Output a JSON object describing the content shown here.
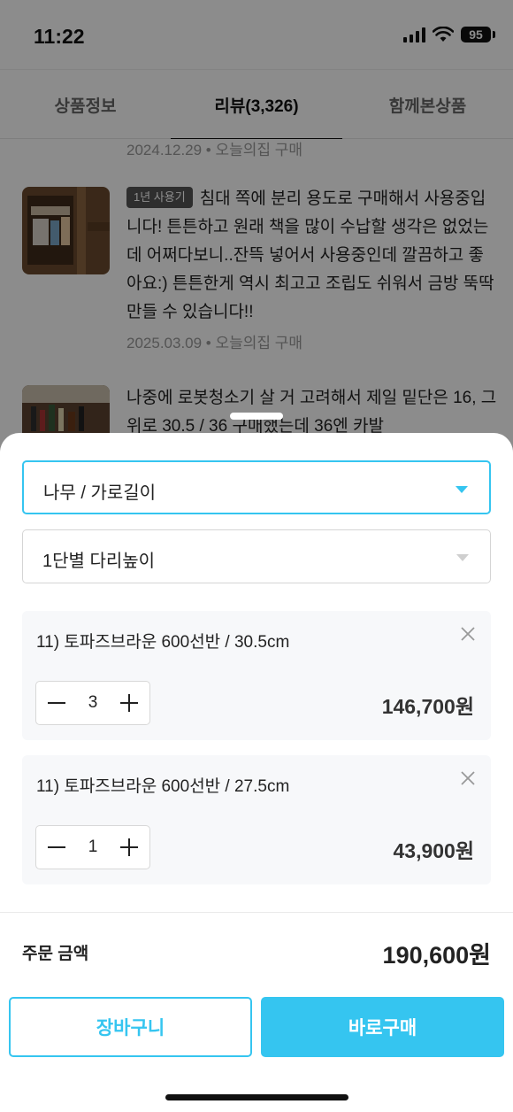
{
  "status_bar": {
    "time": "11:22",
    "battery": "95"
  },
  "tabs": [
    {
      "label": "상품정보"
    },
    {
      "label": "리뷰(3,326)"
    },
    {
      "label": "함께본상품"
    }
  ],
  "reviews": [
    {
      "meta": "2024.12.29 • 오늘의집 구매"
    },
    {
      "badge": "1년 사용기",
      "text": "침대 쪽에 분리 용도로 구매해서 사용중입니다! 튼튼하고 원래 책을 많이 수납할 생각은 없었는데 어쩌다보니..잔뜩 넣어서 사용중인데 깔끔하고 좋아요:) 튼튼한게 역시 최고고 조립도 쉬워서 금방 뚝딱 만들 수 있습니다!!",
      "meta": "2025.03.09 • 오늘의집 구매"
    },
    {
      "text": "나중에 로봇청소기 살 거 고려해서 제일 밑단은 16, 그 위로 30.5 / 36 구매했는데 36엔 카발"
    }
  ],
  "options": {
    "option1": "나무 / 가로길이",
    "option2": "1단별 다리높이"
  },
  "items": [
    {
      "name": "11) 토파즈브라운 600선반 / 30.5cm",
      "qty": "3",
      "price": "146,700원"
    },
    {
      "name": "11) 토파즈브라운 600선반 / 27.5cm",
      "qty": "1",
      "price": "43,900원"
    }
  ],
  "total": {
    "label": "주문 금액",
    "price": "190,600원"
  },
  "buttons": {
    "cart": "장바구니",
    "buy": "바로구매"
  },
  "colors": {
    "accent": "#35c5f0"
  }
}
